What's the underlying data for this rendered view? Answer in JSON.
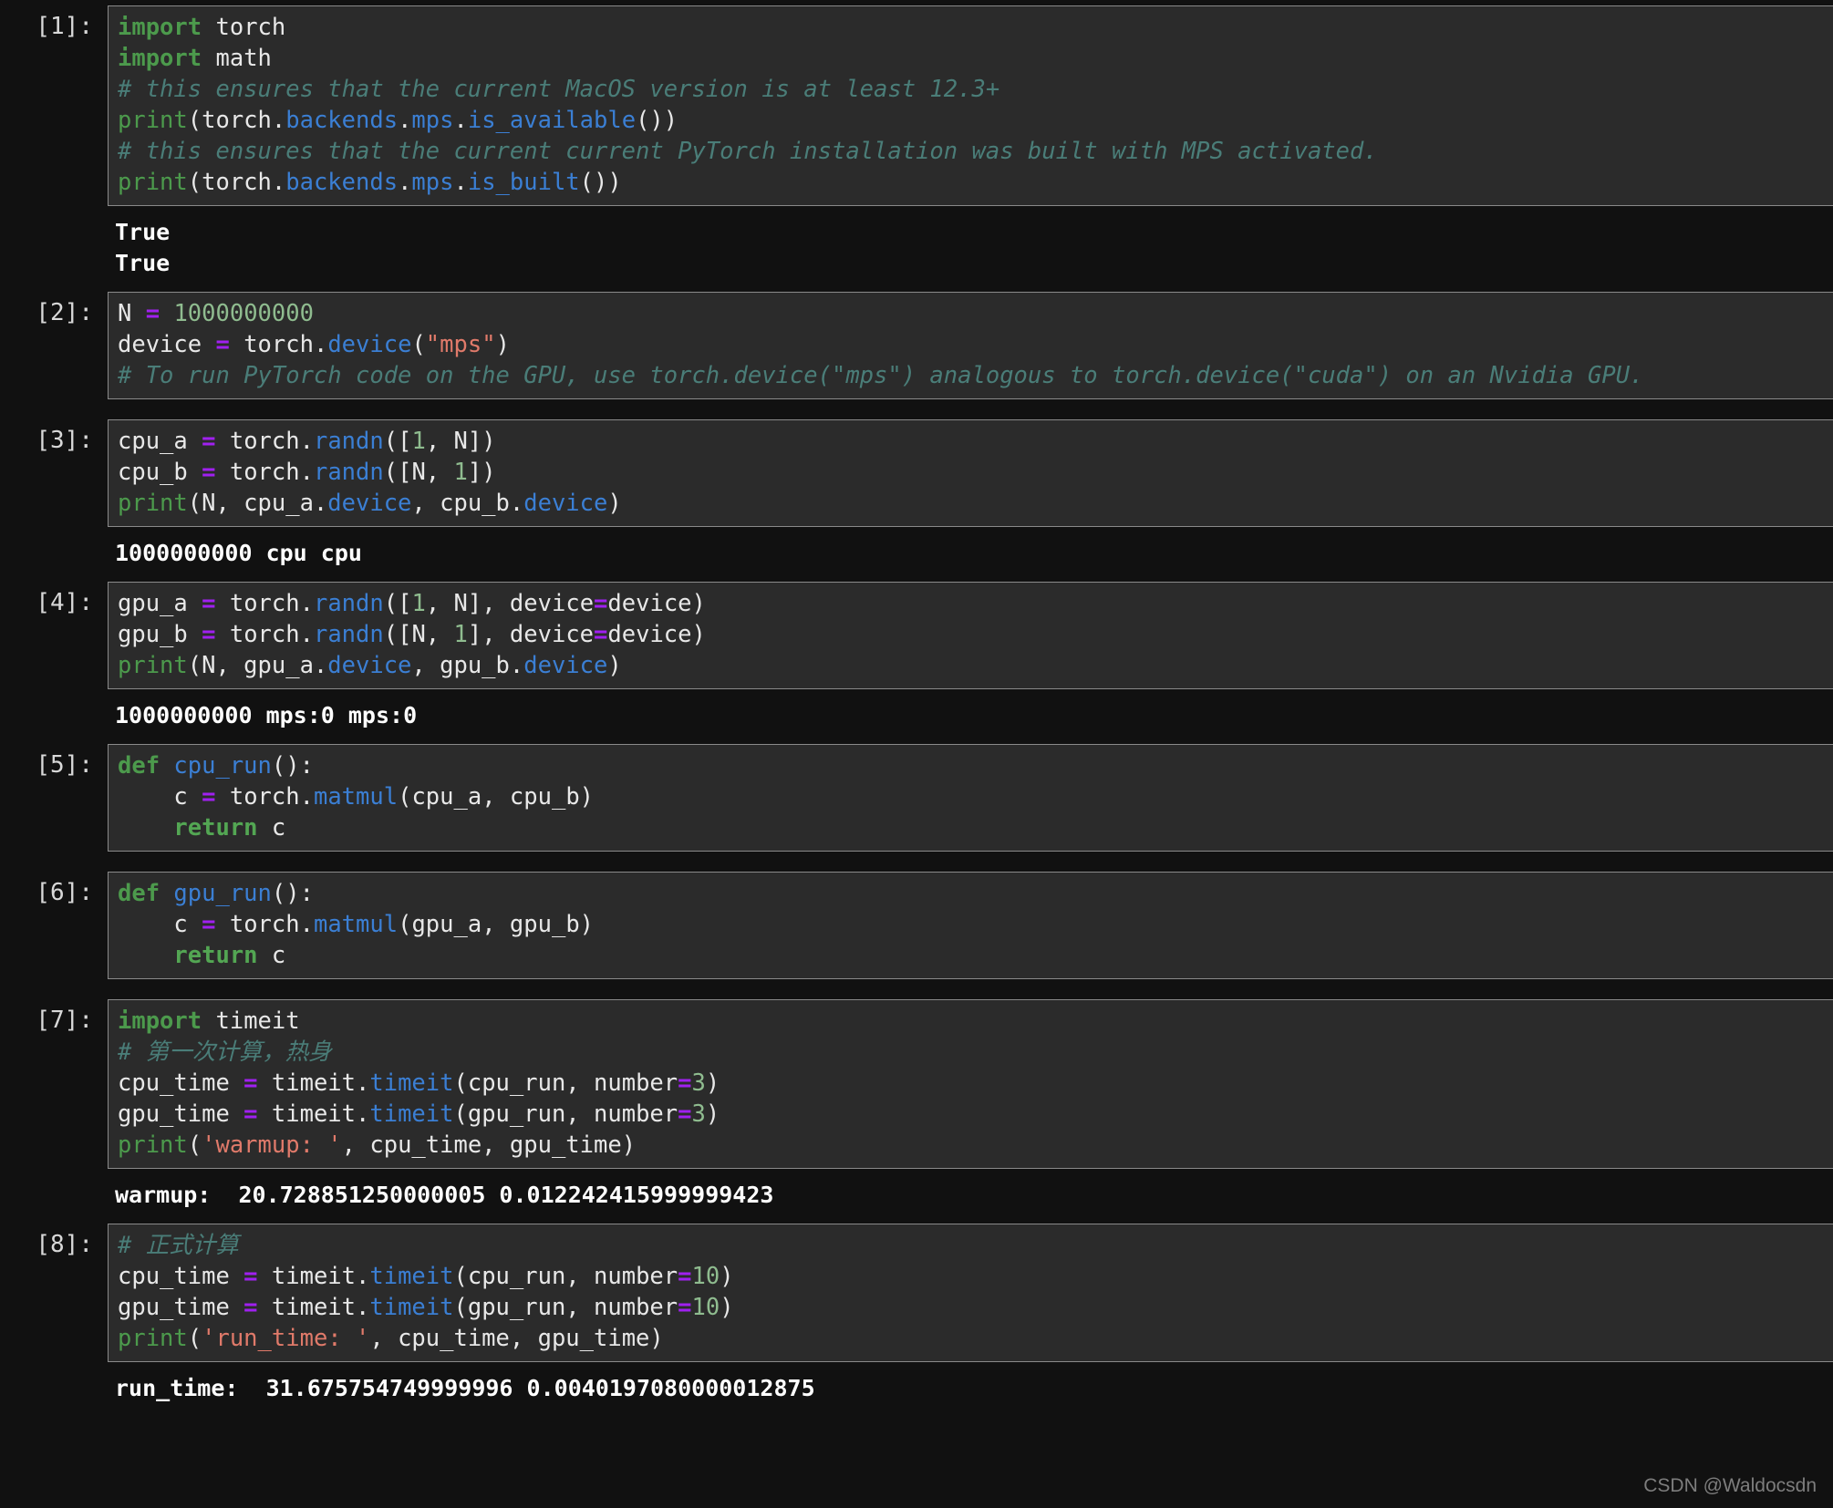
{
  "notebook": {
    "kernel_language": "python",
    "theme": "dark",
    "colors": {
      "page_background": "#111111",
      "cell_background": "#2b2b2b",
      "cell_border": "#8a8a8a",
      "keyword": "#4c9a4c",
      "comment": "#4a7d78",
      "builtin_attribute": "#3b7fd4",
      "number": "#8fbc8f",
      "string": "#e07a6a",
      "operator": "#a020f0",
      "plain_text": "#e8e8e8",
      "output_text": "#ffffff",
      "watermark": "#7d7d7d"
    },
    "cells": [
      {
        "prompt": "[1]:",
        "source_lines": [
          "import torch",
          "import math",
          "# this ensures that the current MacOS version is at least 12.3+",
          "print(torch.backends.mps.is_available())",
          "# this ensures that the current current PyTorch installation was built with MPS activated.",
          "print(torch.backends.mps.is_built())"
        ],
        "output_lines": [
          "True",
          "True"
        ]
      },
      {
        "prompt": "[2]:",
        "source_lines": [
          "N = 1000000000",
          "device = torch.device(\"mps\")",
          "# To run PyTorch code on the GPU, use torch.device(\"mps\") analogous to torch.device(\"cuda\") on an Nvidia GPU."
        ],
        "output_lines": []
      },
      {
        "prompt": "[3]:",
        "source_lines": [
          "cpu_a = torch.randn([1, N])",
          "cpu_b = torch.randn([N, 1])",
          "print(N, cpu_a.device, cpu_b.device)"
        ],
        "output_lines": [
          "1000000000 cpu cpu"
        ]
      },
      {
        "prompt": "[4]:",
        "source_lines": [
          "gpu_a = torch.randn([1, N], device=device)",
          "gpu_b = torch.randn([N, 1], device=device)",
          "print(N, gpu_a.device, gpu_b.device)"
        ],
        "output_lines": [
          "1000000000 mps:0 mps:0"
        ]
      },
      {
        "prompt": "[5]:",
        "source_lines": [
          "def cpu_run():",
          "    c = torch.matmul(cpu_a, cpu_b)",
          "    return c"
        ],
        "output_lines": []
      },
      {
        "prompt": "[6]:",
        "source_lines": [
          "def gpu_run():",
          "    c = torch.matmul(gpu_a, gpu_b)",
          "    return c"
        ],
        "output_lines": []
      },
      {
        "prompt": "[7]:",
        "source_lines": [
          "import timeit",
          "# 第一次计算，热身",
          "cpu_time = timeit.timeit(cpu_run, number=3)",
          "gpu_time = timeit.timeit(gpu_run, number=3)",
          "print('warmup: ', cpu_time, gpu_time)"
        ],
        "output_lines": [
          "warmup:  20.728851250000005 0.012242415999999423"
        ]
      },
      {
        "prompt": "[8]:",
        "source_lines": [
          "# 正式计算",
          "cpu_time = timeit.timeit(cpu_run, number=10)",
          "gpu_time = timeit.timeit(gpu_run, number=10)",
          "print('run_time: ', cpu_time, gpu_time)"
        ],
        "output_lines": [
          "run_time:  31.675754749999996 0.0040197080000012875"
        ]
      }
    ]
  },
  "watermark": {
    "text": "CSDN @Waldocsdn"
  },
  "prompts": {
    "c1": "[1]:",
    "c2": "[2]:",
    "c3": "[3]:",
    "c4": "[4]:",
    "c5": "[5]:",
    "c6": "[6]:",
    "c7": "[7]:",
    "c8": "[8]:"
  },
  "outputs": {
    "o1": "True\nTrue",
    "o3": "1000000000 cpu cpu",
    "o4": "1000000000 mps:0 mps:0",
    "o7": "warmup:  20.728851250000005 0.012242415999999423",
    "o8": "run_time:  31.675754749999996 0.0040197080000012875"
  }
}
